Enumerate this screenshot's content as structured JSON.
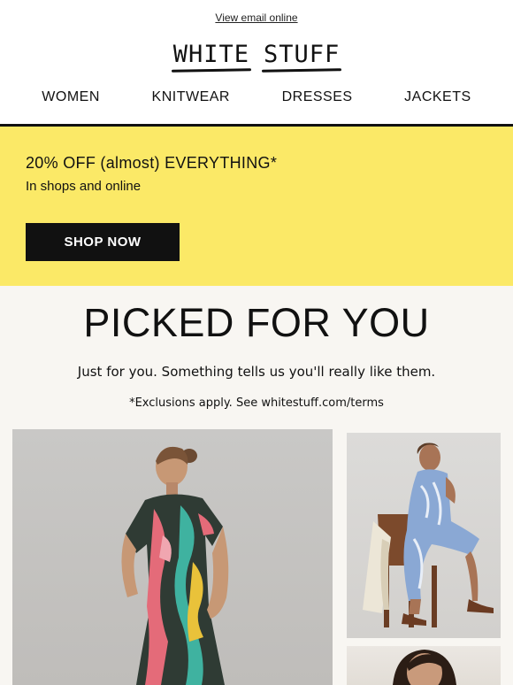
{
  "header": {
    "view_online": "View email online",
    "logo": {
      "word1": "WHITE",
      "word2": "STUFF"
    }
  },
  "nav": {
    "items": [
      {
        "label": "WOMEN"
      },
      {
        "label": "KNITWEAR"
      },
      {
        "label": "DRESSES"
      },
      {
        "label": "JACKETS"
      }
    ]
  },
  "promo": {
    "title": "20% OFF (almost) EVERYTHING*",
    "subtitle": "In shops and online",
    "button": "SHOP NOW",
    "background": "#fbe967"
  },
  "picked": {
    "title": "PICKED FOR YOU",
    "subtitle": "Just for you. Something tells us you'll really like them.",
    "note": "*Exclusions apply. See whitestuff.com/terms",
    "background": "#f8f6f2"
  },
  "products": [
    {
      "kind": "model in tropical print shirt dress"
    },
    {
      "kind": "model seated in blue print dress"
    },
    {
      "kind": "model portrait"
    }
  ]
}
